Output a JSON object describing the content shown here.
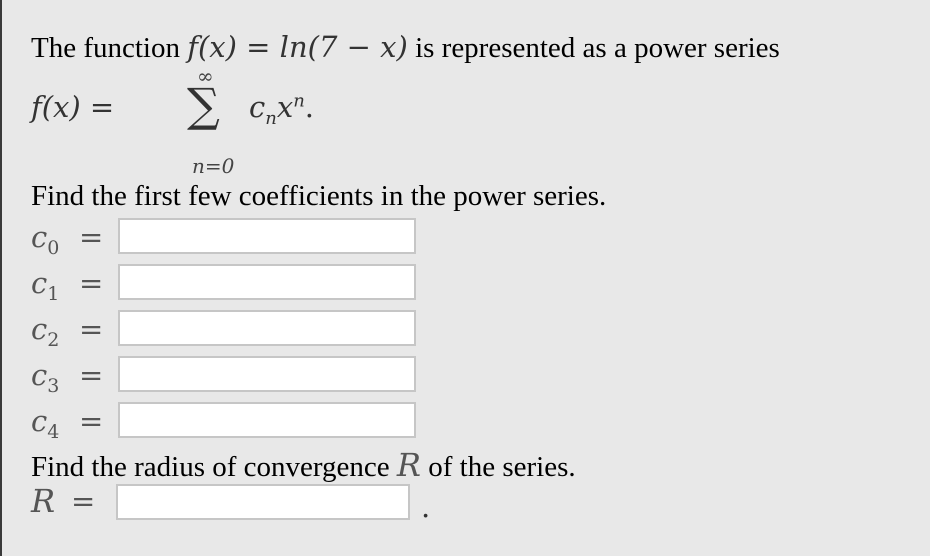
{
  "problem": {
    "intro_text_before": "The function",
    "function_expr": "f(x) = ln(7 − x)",
    "intro_text_after": "is represented as a power series",
    "series": {
      "lhs": "f(x) =",
      "sigma": "∑",
      "upper_limit": "∞",
      "lower_limit": "n=0",
      "term_coef": "c",
      "term_coef_sub": "n",
      "term_var": "x",
      "term_exp": "n",
      "term_end": "."
    },
    "coefficients_prompt": "Find the first few coefficients in the power series.",
    "coefficients": [
      {
        "label": "c",
        "sub": "0",
        "eq": "=",
        "value": ""
      },
      {
        "label": "c",
        "sub": "1",
        "eq": "=",
        "value": ""
      },
      {
        "label": "c",
        "sub": "2",
        "eq": "=",
        "value": ""
      },
      {
        "label": "c",
        "sub": "3",
        "eq": "=",
        "value": ""
      },
      {
        "label": "c",
        "sub": "4",
        "eq": "=",
        "value": ""
      }
    ],
    "radius_prompt_before": "Find the radius of convergence",
    "radius_symbol": "R",
    "radius_prompt_after": "of the series.",
    "radius": {
      "label": "R",
      "eq": "=",
      "value": "",
      "end": "."
    }
  }
}
